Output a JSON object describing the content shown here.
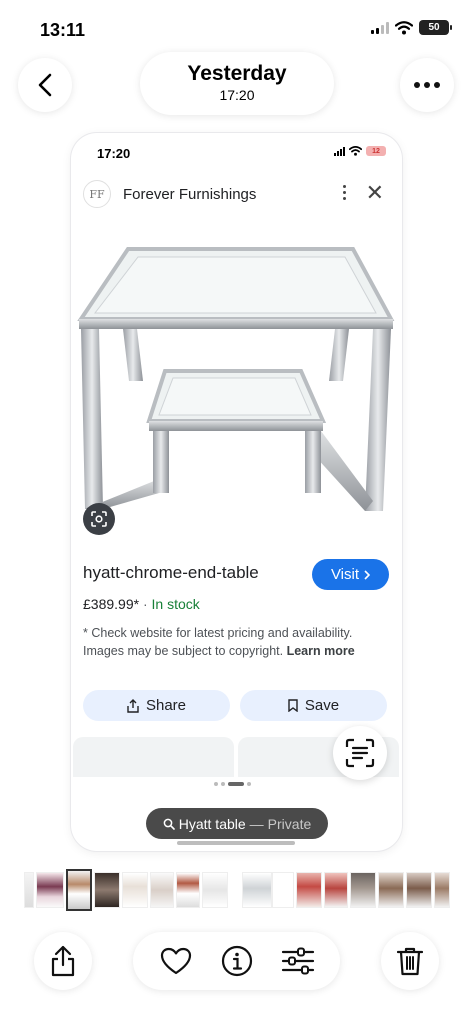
{
  "status_bar": {
    "time": "13:11",
    "battery": "50"
  },
  "header": {
    "title": "Yesterday",
    "subtitle": "17:20"
  },
  "screenshot": {
    "status_time": "17:20",
    "status_battery": "12",
    "source": {
      "favicon_text": "FF",
      "name": "Forever Furnishings"
    },
    "product": {
      "title": "hyatt-chrome-end-table",
      "visit_label": "Visit",
      "price": "£389.99*",
      "separator": "·",
      "stock": "In stock",
      "disclaimer": "* Check website for latest pricing and availability. Images may be subject to copyright.",
      "learn_more": "Learn more"
    },
    "actions": {
      "share_label": "Share",
      "save_label": "Save"
    },
    "search_chip": {
      "query": "Hyatt table",
      "dash": "—",
      "privacy": "Private"
    }
  },
  "filmstrip": {
    "count": 15,
    "selected_index": 1
  },
  "toolbar": {
    "icons": [
      "share-icon",
      "heart-icon",
      "info-icon",
      "sliders-icon",
      "trash-icon"
    ]
  },
  "colors": {
    "accent": "#1a73e8",
    "in_stock": "#188038",
    "button_tint": "#e8f0fe"
  }
}
